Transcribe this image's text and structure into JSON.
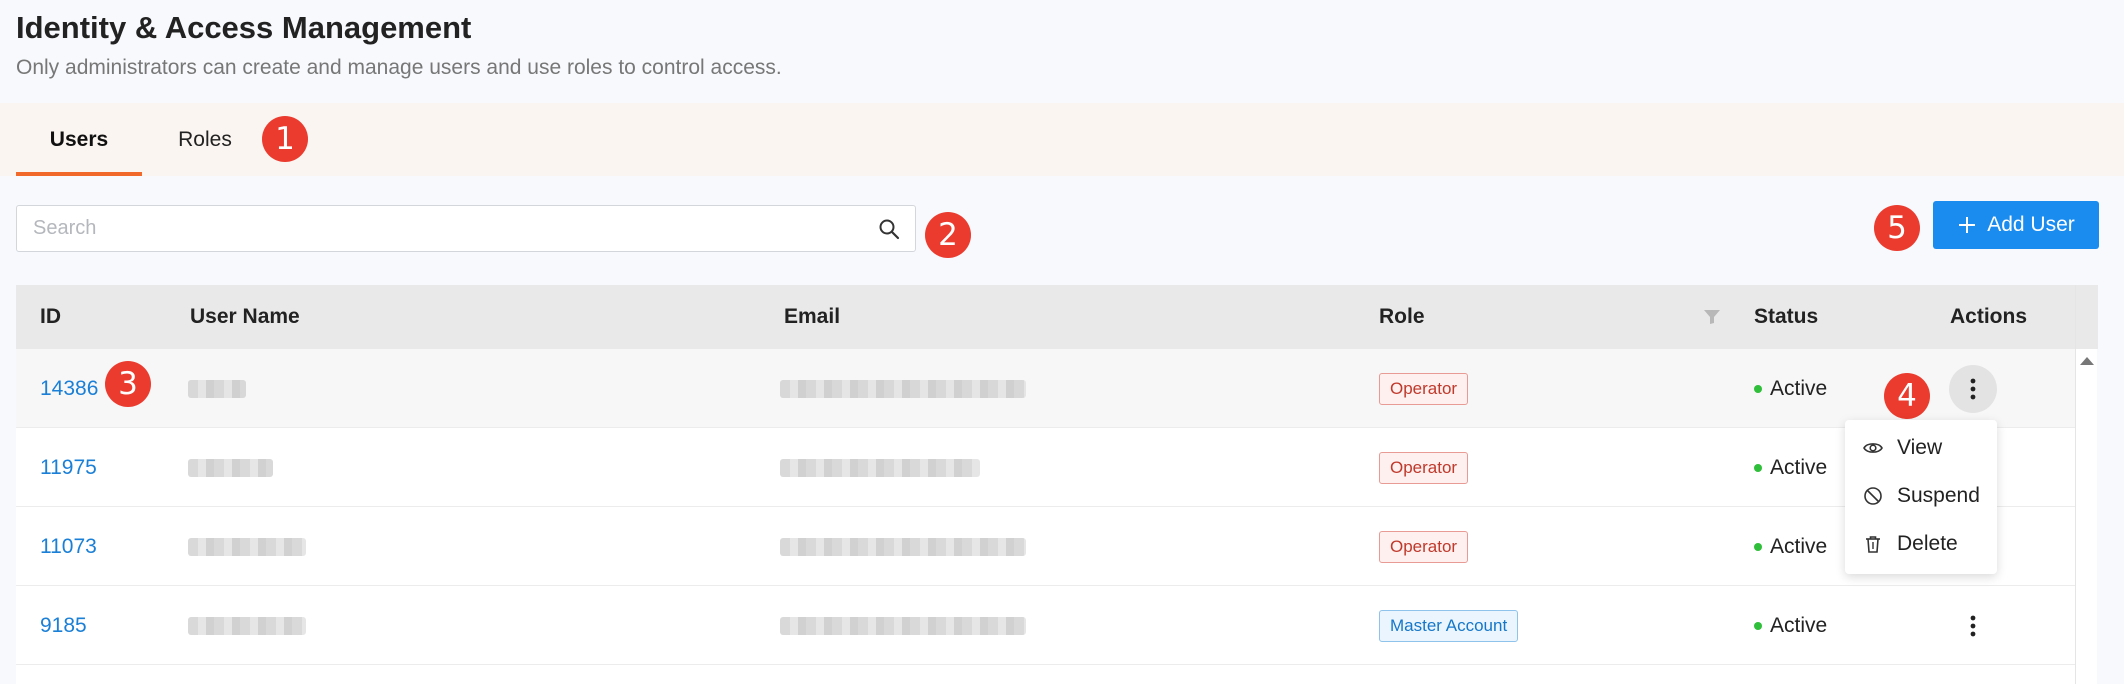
{
  "page": {
    "title": "Identity & Access Management",
    "subtitle": "Only administrators can create and manage users and use roles to control access."
  },
  "tabs": [
    {
      "label": "Users",
      "active": true
    },
    {
      "label": "Roles",
      "active": false
    }
  ],
  "search": {
    "placeholder": "Search",
    "value": "",
    "icon": "search-icon"
  },
  "add_user": {
    "label": "Add User",
    "icon": "plus-icon"
  },
  "markers": [
    "1",
    "2",
    "3",
    "4",
    "5"
  ],
  "table": {
    "columns": {
      "id": "ID",
      "user_name": "User Name",
      "email": "Email",
      "role": "Role",
      "status": "Status",
      "actions": "Actions"
    },
    "rows": [
      {
        "id": "14386",
        "role": "Operator",
        "status": "Active"
      },
      {
        "id": "11975",
        "role": "Operator",
        "status": "Active"
      },
      {
        "id": "11073",
        "role": "Operator",
        "status": "Active"
      },
      {
        "id": "9185",
        "role": "Master Account",
        "status": "Active"
      }
    ]
  },
  "action_menu": {
    "items": [
      {
        "label": "View",
        "icon": "eye-icon"
      },
      {
        "label": "Suspend",
        "icon": "ban-icon"
      },
      {
        "label": "Delete",
        "icon": "trash-icon"
      }
    ]
  },
  "colors": {
    "accent": "#1a8cf0",
    "tab_underline": "#f26a2b",
    "marker": "#ea3b2e",
    "status_active": "#2fbf3a",
    "link": "#1a7fd6"
  }
}
